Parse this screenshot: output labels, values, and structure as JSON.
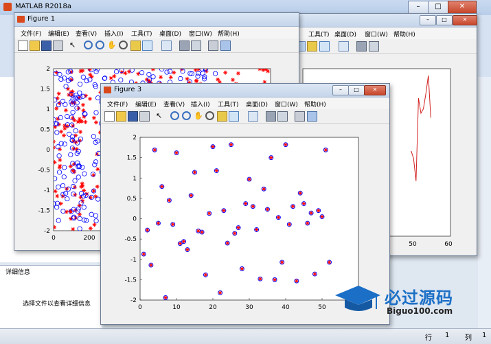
{
  "main": {
    "title": "MATLAB R2018a",
    "details_title": "详细信息",
    "details_message": "选择文件以查看详细信息",
    "status_row_label": "行",
    "status_row_value": "1",
    "status_col_label": "列",
    "status_col_value": "1"
  },
  "menu_labels": [
    "文件(F)",
    "编辑(E)",
    "查看(V)",
    "插入(I)",
    "工具(T)",
    "桌面(D)",
    "窗口(W)",
    "帮助(H)"
  ],
  "figure1": {
    "title": "Figure 1",
    "xticks": [
      "0",
      "200"
    ],
    "yticks": [
      "2",
      "1.5",
      "1",
      "0.5",
      "0",
      "-0.5",
      "-1",
      "-1.5",
      "-2"
    ]
  },
  "figure2": {
    "xticks": [
      "50",
      "60"
    ]
  },
  "figure3": {
    "title": "Figure 3",
    "xticks": [
      "0",
      "10",
      "20",
      "30",
      "40",
      "50"
    ],
    "yticks": [
      "2",
      "1.5",
      "1",
      "0.5",
      "0",
      "-0.5",
      "-1",
      "-1.5",
      "-2"
    ]
  },
  "watermark": {
    "brand": "必过源码",
    "url": "Biguo100.com"
  },
  "chart_data": [
    {
      "type": "scatter",
      "figure": "Figure 3",
      "xlim": [
        0,
        60
      ],
      "ylim": [
        -2,
        2
      ],
      "grid": false,
      "markers": [
        "red asterisk",
        "blue circle"
      ],
      "x": [
        1,
        2,
        3,
        4,
        5,
        6,
        7,
        8,
        9,
        10,
        11,
        12,
        13,
        14,
        15,
        16,
        17,
        18,
        19,
        20,
        21,
        22,
        23,
        24,
        25,
        26,
        27,
        28,
        29,
        30,
        31,
        32,
        33,
        34,
        35,
        36,
        37,
        38,
        39,
        40,
        41,
        42,
        43,
        44,
        45,
        46,
        47,
        48,
        49,
        50,
        51,
        52
      ],
      "y": [
        -0.87,
        -0.28,
        -1.14,
        1.69,
        -0.11,
        0.79,
        -1.94,
        0.45,
        -0.14,
        1.62,
        -0.61,
        -0.56,
        -0.76,
        0.57,
        1.14,
        -0.3,
        -0.33,
        -1.38,
        0.13,
        1.77,
        1.18,
        -1.82,
        0.2,
        -0.6,
        1.82,
        -0.36,
        -0.22,
        -1.23,
        0.37,
        0.97,
        0.3,
        -0.27,
        -1.48,
        0.73,
        0.23,
        1.5,
        -1.5,
        0.03,
        -1.07,
        1.82,
        -0.14,
        0.3,
        -1.53,
        0.63,
        0.37,
        -0.11,
        0.14,
        -1.36,
        0.2,
        0.05,
        1.69,
        -1.07
      ]
    },
    {
      "type": "scatter",
      "figure": "Figure 1",
      "xlim": [
        0,
        300
      ],
      "ylim": [
        -2,
        2
      ],
      "grid": false,
      "markers": [
        "red asterisk",
        "blue circle"
      ],
      "note_values": "dense cloud of points"
    },
    {
      "type": "line",
      "figure": "Figure 2",
      "xlim": [
        0,
        60
      ],
      "color": "#d21f1f",
      "x": [
        44,
        45,
        46,
        47,
        48,
        49,
        50,
        51,
        52
      ],
      "y_relative": [
        0.5,
        0.45,
        0.3,
        0.85,
        0.75,
        0.78,
        0.88,
        1.0,
        0.72
      ]
    }
  ],
  "colors": {
    "star": "#ff0000",
    "circle": "#0000ff",
    "line": "#d21f1f"
  }
}
